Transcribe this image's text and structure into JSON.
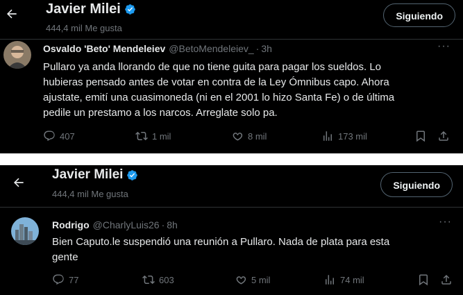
{
  "colors": {
    "background": "#000000",
    "text": "#e7e9ea",
    "muted": "#71767b",
    "verified": "#1d9bf0"
  },
  "screens": [
    {
      "header": {
        "back_icon": "back-arrow-icon",
        "title": "Javier Milei",
        "subtitle": "444,4 mil Me gusta",
        "follow_label": "Siguiendo"
      },
      "tweet": {
        "author_name": "Osvaldo 'Beto' Mendeleiev",
        "author_handle": "@BetoMendeleiev_",
        "separator": "·",
        "time": "3h",
        "more_icon": "more-horizontal-icon",
        "text": "Pullaro ya anda llorando de que no tiene guita para pagar los sueldos. Lo\nhubieras pensado antes de votar en contra de la Ley Ómnibus capo. Ahora\najustate, emití una cuasimoneda (ni en el 2001 lo hizo Santa Fe) o de última\npedile un prestamo a los narcos. Arreglate solo pa.",
        "replies": "407",
        "reposts": "1 mil",
        "likes": "8 mil",
        "views": "173 mil"
      }
    },
    {
      "header": {
        "back_icon": "back-arrow-icon",
        "title": "Javier Milei",
        "subtitle": "444,4 mil Me gusta",
        "follow_label": "Siguiendo"
      },
      "tweet": {
        "author_name": "Rodrigo",
        "author_handle": "@CharlyLuis26",
        "separator": "·",
        "time": "8h",
        "more_icon": "more-horizontal-icon",
        "text": "Bien Caputo.le suspendió una reunión a Pullaro. Nada de plata para esta\ngente",
        "replies": "77",
        "reposts": "603",
        "likes": "5 mil",
        "views": "74 mil"
      }
    }
  ]
}
